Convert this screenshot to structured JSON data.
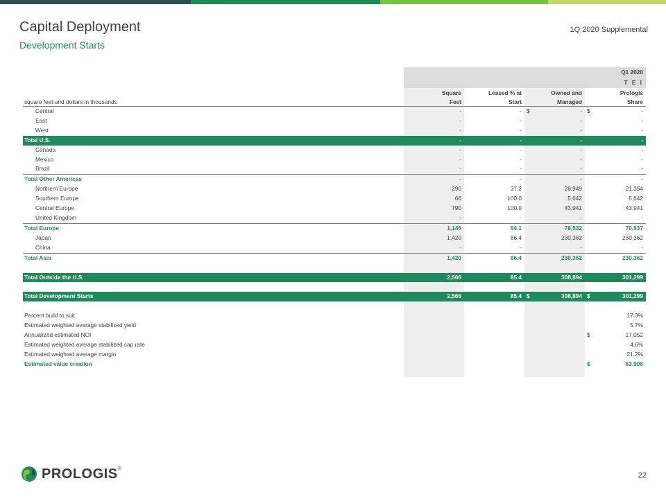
{
  "header": {
    "title": "Capital Deployment",
    "subtitle": "Development Starts",
    "supplemental": "1Q 2020 Supplemental",
    "bar_colors": [
      "#2f4f4f",
      "#1e8a5c",
      "#7bc143",
      "#c5d86d"
    ]
  },
  "table": {
    "period": "Q1 2020",
    "group": "T E I",
    "units_label": "square feet and dollars in thousands",
    "columns": [
      {
        "line1": "Square",
        "line2": "Feet"
      },
      {
        "line1": "Leased % at",
        "line2": "Start"
      },
      {
        "line1": "Owned and",
        "line2": "Managed"
      },
      {
        "line1": "Prologis",
        "line2": "Share"
      }
    ],
    "rows": [
      {
        "label": "Central",
        "v": [
          "-",
          "-",
          "-",
          "-"
        ],
        "d": [
          "",
          "",
          "$",
          "$"
        ]
      },
      {
        "label": "East",
        "v": [
          "-",
          "-",
          "-",
          "-"
        ]
      },
      {
        "label": "West",
        "v": [
          "-",
          "-",
          "-",
          "-"
        ]
      },
      {
        "label": "Total U.S.",
        "v": [
          "-",
          "-",
          "-",
          "-"
        ]
      },
      {
        "label": "Canada",
        "v": [
          "-",
          "-",
          "-",
          "-"
        ]
      },
      {
        "label": "Mexico",
        "v": [
          "-",
          "-",
          "-",
          "-"
        ]
      },
      {
        "label": "Brazil",
        "v": [
          "-",
          "-",
          "-",
          "-"
        ]
      },
      {
        "label": "Total Other Americas",
        "v": [
          "-",
          "-",
          "-",
          "-"
        ]
      },
      {
        "label": "Northern Europe",
        "v": [
          "290",
          "37.2",
          "28,949",
          "21,354"
        ]
      },
      {
        "label": "Southern Europe",
        "v": [
          "66",
          "100.0",
          "5,642",
          "5,642"
        ]
      },
      {
        "label": "Central Europe",
        "v": [
          "790",
          "100.0",
          "43,941",
          "43,941"
        ]
      },
      {
        "label": "United Kingdom",
        "v": [
          "-",
          "-",
          "-",
          "-"
        ]
      },
      {
        "label": "Total Europe",
        "v": [
          "1,146",
          "84.1",
          "78,532",
          "70,937"
        ]
      },
      {
        "label": "Japan",
        "v": [
          "1,420",
          "86.4",
          "230,362",
          "230,362"
        ]
      },
      {
        "label": "China",
        "v": [
          "-",
          "-",
          "-",
          "-"
        ]
      },
      {
        "label": "Total Asia",
        "v": [
          "1,420",
          "86.4",
          "230,362",
          "230,362"
        ]
      },
      {
        "label": "Total Outside the U.S.",
        "v": [
          "2,566",
          "85.4",
          "308,894",
          "301,299"
        ]
      },
      {
        "label": "Total Development Starts",
        "v": [
          "2,566",
          "85.4",
          "308,894",
          "301,299"
        ],
        "d": [
          "",
          "",
          "$",
          "$"
        ]
      }
    ],
    "metrics": [
      {
        "label": "Percent build to suit",
        "value": "17.3%",
        "dollar": ""
      },
      {
        "label": "Estimated weighted average stabilized yield",
        "value": "5.7%",
        "dollar": ""
      },
      {
        "label": "Annualized estimated NOI",
        "value": "17,052",
        "dollar": "$"
      },
      {
        "label": "Estimated weighted average stabilized cap rate",
        "value": "4.6%",
        "dollar": ""
      },
      {
        "label": "Estimated weighted average margin",
        "value": "21.2%",
        "dollar": ""
      },
      {
        "label": "Estimated value creation",
        "value": "63,906",
        "dollar": "$"
      }
    ]
  },
  "footer": {
    "logo": "PROLOGIS",
    "logo_mark": "®",
    "page": "22"
  }
}
